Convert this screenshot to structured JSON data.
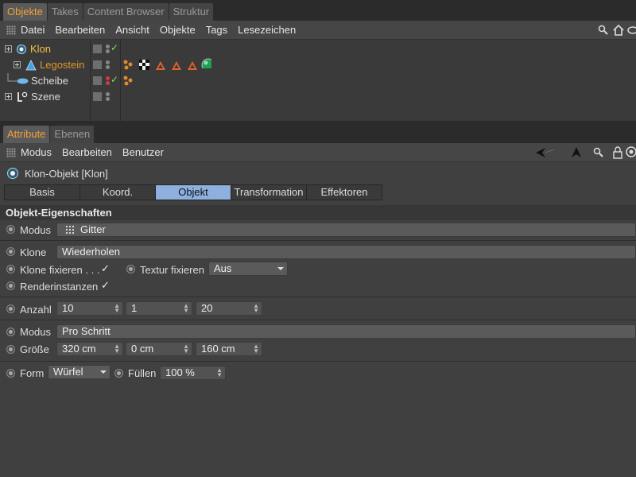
{
  "top_tabs": [
    "Objekte",
    "Takes",
    "Content Browser",
    "Struktur"
  ],
  "top_menu": [
    "Datei",
    "Bearbeiten",
    "Ansicht",
    "Objekte",
    "Tags",
    "Lesezeichen"
  ],
  "objects": [
    {
      "name": "Klon",
      "color": "#f2c23a",
      "icon": "cloner-icon"
    },
    {
      "name": "Legostein",
      "color": "#e2962a",
      "icon": "polygon-object-icon"
    },
    {
      "name": "Scheibe",
      "color": "#dddddd",
      "icon": "disc-icon"
    },
    {
      "name": "Szene",
      "color": "#dddddd",
      "icon": "null-object-icon"
    }
  ],
  "attr_tabs": [
    "Attribute",
    "Ebenen"
  ],
  "attr_menu": [
    "Modus",
    "Bearbeiten",
    "Benutzer"
  ],
  "object_title": "Klon-Objekt [Klon]",
  "button_tabs": [
    "Basis",
    "Koord.",
    "Objekt",
    "Transformation",
    "Effektoren"
  ],
  "active_button_tab": "Objekt",
  "section_title": "Objekt-Eigenschaften",
  "props": {
    "modus_label": "Modus",
    "modus_value": "Gitter",
    "klone_label": "Klone",
    "klone_value": "Wiederholen",
    "klone_fixieren_label": "Klone fixieren . . .",
    "klone_fixieren_check": "✓",
    "textur_fixieren_label": "Textur fixieren",
    "textur_fixieren_value": "Aus",
    "renderinstanzen_label": "Renderinstanzen",
    "renderinstanzen_check": "✓",
    "anzahl_label": "Anzahl",
    "anzahl_values": [
      "10",
      "1",
      "20"
    ],
    "modus2_label": "Modus",
    "modus2_value": "Pro Schritt",
    "groesse_label": "Größe",
    "groesse_values": [
      "320 cm",
      "0 cm",
      "160 cm"
    ],
    "form_label": "Form",
    "form_value": "Würfel",
    "fuellen_label": "Füllen",
    "fuellen_value": "100 %"
  },
  "colors": {
    "accent": "#f2a13a",
    "active_tab": "#8db0df",
    "check": "#7fdc6b"
  }
}
